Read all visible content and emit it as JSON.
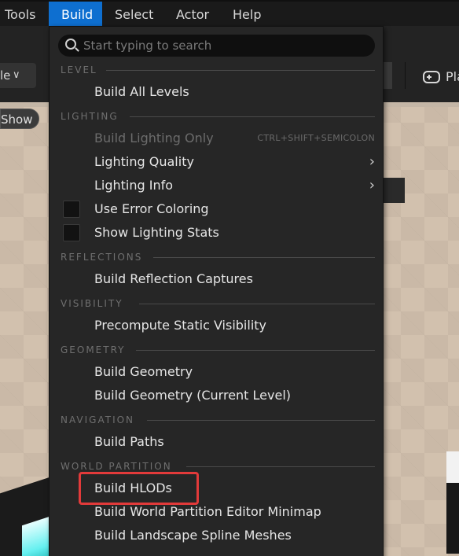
{
  "menubar": {
    "items": [
      {
        "label": "Tools",
        "active": false
      },
      {
        "label": "Build",
        "active": true
      },
      {
        "label": "Select",
        "active": false
      },
      {
        "label": "Actor",
        "active": false
      },
      {
        "label": "Help",
        "active": false
      }
    ]
  },
  "toolbar": {
    "mode_label": "le",
    "play_label": "Pla",
    "show_label": "Show"
  },
  "dropdown": {
    "search_placeholder": "Start typing to search",
    "sections": {
      "level": "LEVEL",
      "lighting": "LIGHTING",
      "reflections": "REFLECTIONS",
      "visibility": "VISIBILITY",
      "geometry": "GEOMETRY",
      "navigation": "NAVIGATION",
      "world_partition": "WORLD PARTITION"
    },
    "items": {
      "build_all_levels": "Build All Levels",
      "build_lighting_only": "Build Lighting Only",
      "build_lighting_only_shortcut": "CTRL+SHIFT+SEMICOLON",
      "lighting_quality": "Lighting Quality",
      "lighting_info": "Lighting Info",
      "use_error_coloring": "Use Error Coloring",
      "show_lighting_stats": "Show Lighting Stats",
      "build_reflection_captures": "Build Reflection Captures",
      "precompute_static_visibility": "Precompute Static Visibility",
      "build_geometry": "Build Geometry",
      "build_geometry_current": "Build Geometry (Current Level)",
      "build_paths": "Build Paths",
      "build_hlods": "Build HLODs",
      "build_wp_minimap": "Build World Partition Editor Minimap",
      "build_landscape_spline_meshes": "Build Landscape Spline Meshes"
    },
    "checkboxes": {
      "use_error_coloring": false,
      "show_lighting_stats": false
    }
  },
  "colors": {
    "accent": "#0e6fd0",
    "highlight": "#e23a3a",
    "menu_bg": "#262626"
  }
}
